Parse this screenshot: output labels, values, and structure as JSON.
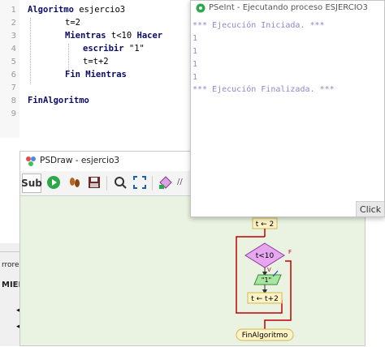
{
  "editor": {
    "line_numbers": [
      "1",
      "2",
      "3",
      "4",
      "5",
      "6",
      "7",
      "8",
      "9"
    ],
    "lines": {
      "l1_kw": "Algoritmo",
      "l1_name": " esjercio3",
      "l2": "t=2",
      "l3_kw1": "Mientras",
      "l3_cond": " t<10 ",
      "l3_kw2": "Hacer",
      "l4_kw": "escribir",
      "l4_str": " \"1\"",
      "l5": "t=t+2",
      "l6": "Fin Mientras",
      "l8": "FinAlgoritmo"
    }
  },
  "left_panel": {
    "label1": "rrores",
    "label2": "MIEN"
  },
  "psdraw": {
    "title": "PSDraw - esjercio3",
    "toolbar": {
      "sub_label": "Sub",
      "overflow_label": "//"
    },
    "flowchart": {
      "assign_top": "t ← 2",
      "condition": "t<10",
      "true_label": "V",
      "false_label": "F",
      "output": "\"1\"",
      "assign_loop": "t ← t+2",
      "end": "FinAlgoritmo"
    }
  },
  "pseint": {
    "title": "PSeInt - Ejecutando proceso ESJERCIO3",
    "output_start": "*** Ejecución Iniciada. ***",
    "outputs": [
      "1",
      "1",
      "1",
      "1"
    ],
    "output_end": "*** Ejecución Finalizada. ***",
    "click_label": "Click"
  },
  "colors": {
    "keyword": "#0b0b6e",
    "output_text": "#8a8acc",
    "canvas_bg": "#eaf3e2",
    "loop_line": "#c00000",
    "diamond_fill": "#e6a6f0",
    "process_fill": "#fdf3c6"
  }
}
